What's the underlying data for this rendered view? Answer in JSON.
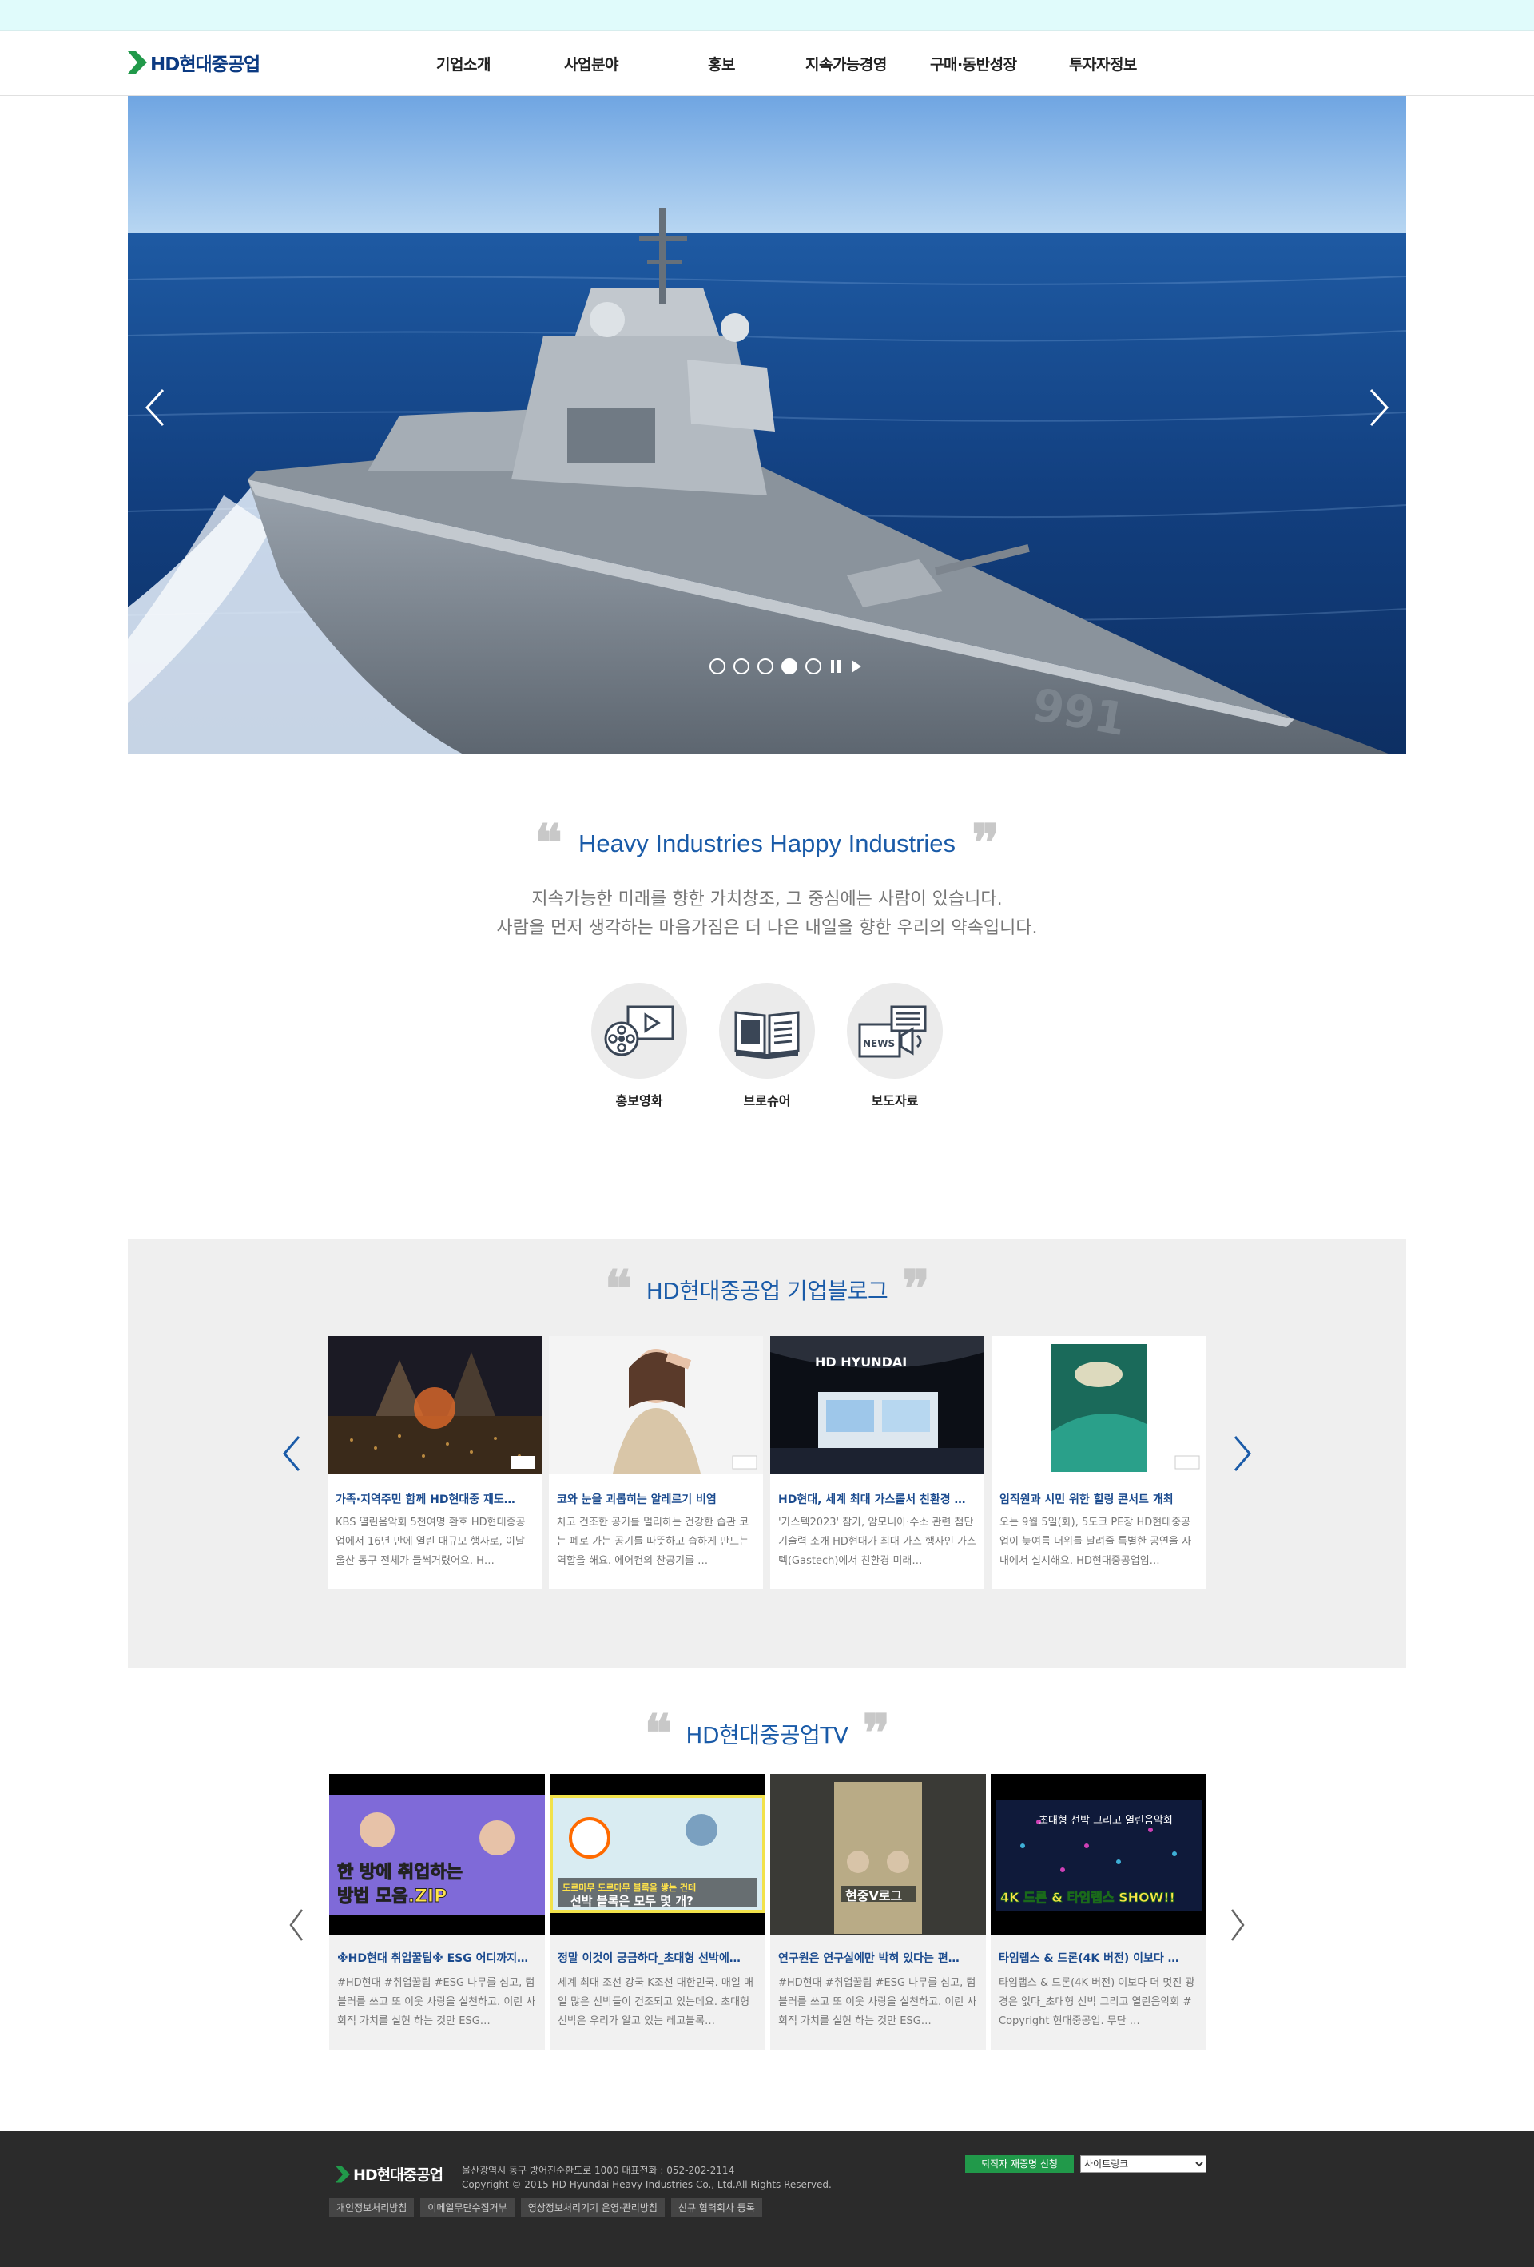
{
  "header": {
    "logo_text": "HD현대중공업",
    "nav": [
      "기업소개",
      "사업분야",
      "홍보",
      "지속가능경영",
      "구매·동반성장",
      "투자자정보"
    ]
  },
  "hero": {
    "slide_count": 5,
    "active_slide": 4,
    "ship_number": "991"
  },
  "intro": {
    "title": "Heavy Industries Happy Industries",
    "line1": "지속가능한 미래를 향한 가치창조, 그 중심에는 사람이 있습니다.",
    "line2": "사람을 먼저 생각하는 마음가짐은 더 나은 내일을 향한 우리의 약속입니다.",
    "quick_links": [
      {
        "label": "홍보영화",
        "icon": "film-reel-icon"
      },
      {
        "label": "브로슈어",
        "icon": "brochure-book-icon"
      },
      {
        "label": "보도자료",
        "icon": "news-icon"
      }
    ]
  },
  "blog": {
    "title": "HD현대중공업 기업블로그",
    "cards": [
      {
        "title": "가족·지역주민 함께 HD현대중 재도…",
        "desc": "KBS 열린음악회 5천여명 환호 HD현대중공업에서 16년 만에 열린 대규모 행사로, 이날 울산 동구 전체가 들썩거렸어요. H…"
      },
      {
        "title": "코와 눈을 괴롭히는 알레르기 비염",
        "desc": "차고 건조한 공기를 멀리하는 건강한 습관 코는 폐로 가는 공기를 따뜻하고 습하게 만드는 역할을 해요. 에어컨의 찬공기를 …"
      },
      {
        "title": "HD현대, 세계 최대 가스롤서 친환경 …",
        "desc": "'가스텍2023' 참가, 암모니아·수소 관련 첨단기술력 소개 HD현대가 최대 가스 행사인 가스텍(Gastech)에서 친환경 미래…"
      },
      {
        "title": "임직원과 시민 위한 힐링 콘서트 개최",
        "desc": "오는 9월 5일(화), 5도크 PE장 HD현대중공업이 늦여름 더위를 날려줄 특별한 공연을 사내에서 실시해요. HD현대중공업임…"
      }
    ]
  },
  "tv": {
    "title": "HD현대중공업TV",
    "cards": [
      {
        "title": "※HD현대 취업꿀팁※ ESG 어디까지…",
        "desc": "#HD현대 #취업꿀팁 #ESG 나무를 심고, 텀블러를 쓰고 또 이웃 사랑을 실천하고. 이런 사회적 가치를 실현 하는 것만 ESG…",
        "thumb_top": "한 방에 취업하는",
        "thumb_bottom": "방법 모음.ZIP"
      },
      {
        "title": "정말 이것이 궁금하다_초대형 선박에…",
        "desc": "세계 최대 조선 강국 K조선 대한민국. 매일 매일 많은 선박들이 건조되고 있는데요. 초대형 선박은 우리가 알고 있는 레고블록…",
        "thumb_top": "도르마무 도르마무 블록을 쌓는 건데",
        "thumb_bottom": "선박 블록은 모두 몇 개?"
      },
      {
        "title": "연구원은 연구실에만 박혀 있다는 편…",
        "desc": "#HD현대 #취업꿀팁 #ESG 나무를 심고, 텀블러를 쓰고 또 이웃 사랑을 실천하고. 이런 사회적 가치를 실현 하는 것만 ESG…",
        "thumb_top": "",
        "thumb_bottom": "현중V로그"
      },
      {
        "title": "타임랩스 & 드론(4K 버전) 이보다 …",
        "desc": "타임랩스 & 드론(4K 버전) 이보다 더 멋진 광경은 없다_초대형 선박 그리고 열린음악회 # Copyright 현대중공업. 무단 …",
        "thumb_top": "초대형 선박 그리고 열린음악회",
        "thumb_bottom": "4K 드론 & 타임랩스 SHOW!!"
      }
    ]
  },
  "footer": {
    "logo_text": "HD현대중공업",
    "address": "울산광역시 동구 방어진순환도로 1000 대표전화 : 052-202-2114",
    "copyright": "Copyright © 2015 HD Hyundai Heavy Industries Co., Ltd.All Rights Reserved.",
    "links": [
      "개인정보처리방침",
      "이메일무단수집거부",
      "영상정보처리기기 운영·관리방침",
      "신규 협력회사 등록"
    ],
    "retire_button": "퇴직자 재증명 신청",
    "sitelink_label": "사이트링크"
  },
  "colors": {
    "brand_blue": "#0b3a82",
    "title_blue": "#1a5ba8",
    "brand_green": "#21994a"
  }
}
